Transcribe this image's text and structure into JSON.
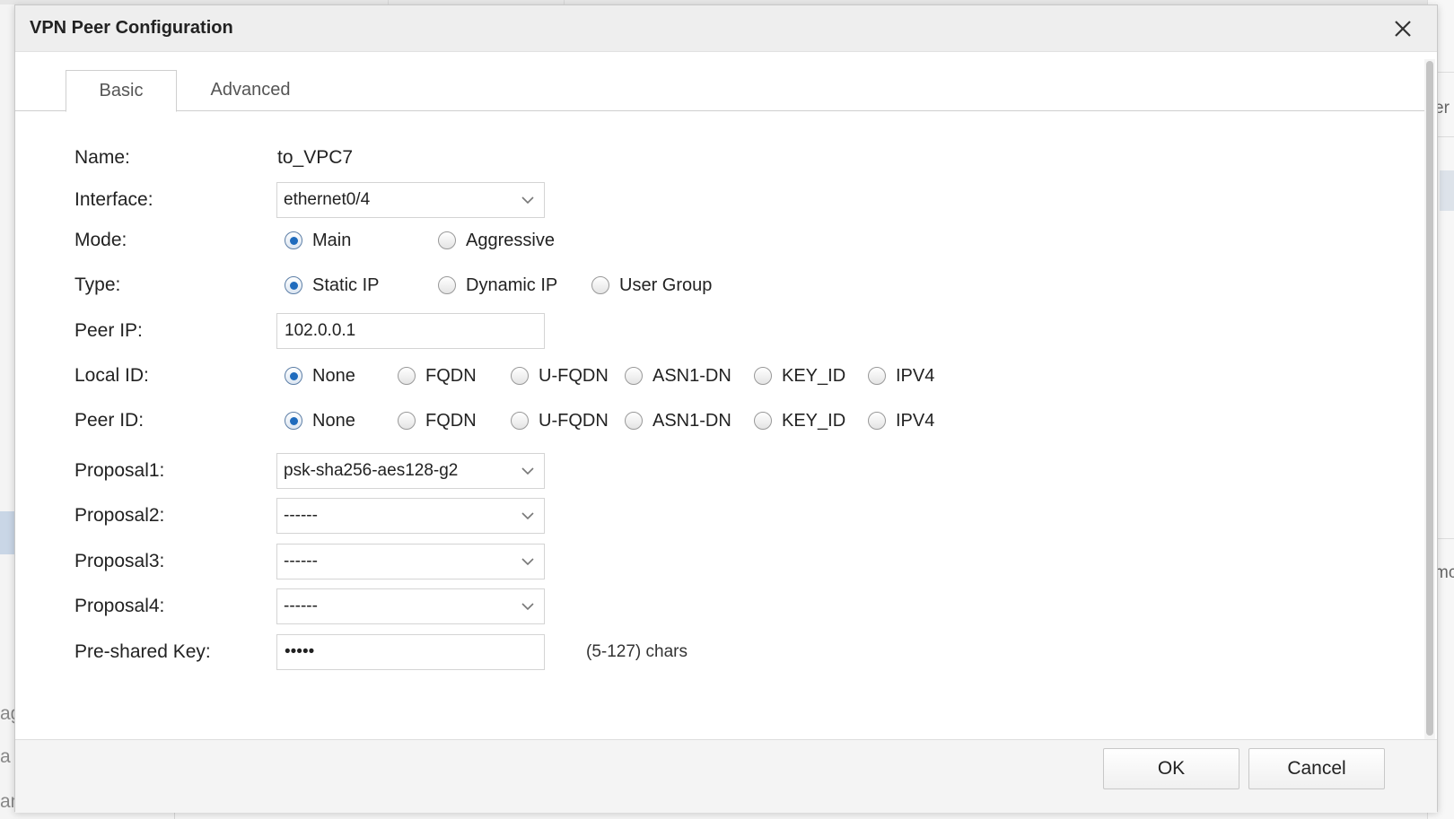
{
  "background": {
    "right_texts": [
      "er",
      "mc"
    ],
    "left_texts": [
      "ag",
      "a",
      "ameters"
    ]
  },
  "dialog": {
    "title": "VPN Peer Configuration",
    "tabs": [
      {
        "label": "Basic",
        "active": true
      },
      {
        "label": "Advanced",
        "active": false
      }
    ],
    "fields": {
      "name": {
        "label": "Name:",
        "value": "to_VPC7"
      },
      "interface": {
        "label": "Interface:",
        "value": "ethernet0/4"
      },
      "mode": {
        "label": "Mode:",
        "options": [
          "Main",
          "Aggressive"
        ],
        "selected": "Main"
      },
      "type": {
        "label": "Type:",
        "options": [
          "Static IP",
          "Dynamic IP",
          "User Group"
        ],
        "selected": "Static IP"
      },
      "peer_ip": {
        "label": "Peer IP:",
        "value": "102.0.0.1"
      },
      "local_id": {
        "label": "Local ID:",
        "options": [
          "None",
          "FQDN",
          "U-FQDN",
          "ASN1-DN",
          "KEY_ID",
          "IPV4"
        ],
        "selected": "None"
      },
      "peer_id": {
        "label": "Peer ID:",
        "options": [
          "None",
          "FQDN",
          "U-FQDN",
          "ASN1-DN",
          "KEY_ID",
          "IPV4"
        ],
        "selected": "None"
      },
      "proposal1": {
        "label": "Proposal1:",
        "value": "psk-sha256-aes128-g2"
      },
      "proposal2": {
        "label": "Proposal2:",
        "value": "------"
      },
      "proposal3": {
        "label": "Proposal3:",
        "value": "------"
      },
      "proposal4": {
        "label": "Proposal4:",
        "value": "------"
      },
      "preshared_key": {
        "label": "Pre-shared Key:",
        "value": "•••••",
        "hint": "(5-127) chars"
      }
    },
    "buttons": {
      "ok": "OK",
      "cancel": "Cancel"
    }
  },
  "colors": {
    "accent": "#1f6bbd",
    "title_bar": "#eeeeee",
    "border": "#d4d4d4"
  },
  "icons": {
    "close": "close-icon",
    "dropdown": "chevron-down-icon"
  }
}
